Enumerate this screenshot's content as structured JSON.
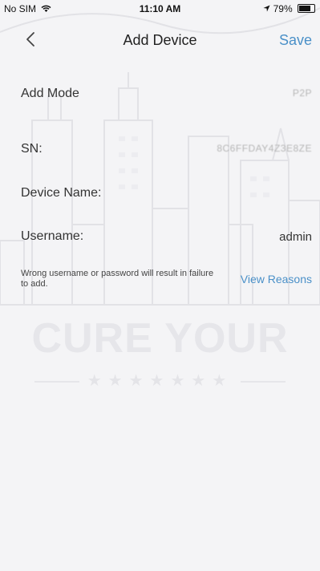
{
  "status_bar": {
    "carrier": "No SIM",
    "wifi_icon": "wifi-icon",
    "time": "11:10 AM",
    "location_icon": "location-arrow-icon",
    "battery_text": "79%",
    "battery_level_percent": 79
  },
  "nav": {
    "back_icon": "chevron-left-icon",
    "title": "Add Device",
    "save_label": "Save"
  },
  "form": {
    "add_mode": {
      "label": "Add Mode",
      "value": "P2P"
    },
    "sn": {
      "label": "SN:",
      "value": "8C6FFDAY4Z3E8ZE"
    },
    "device_name": {
      "label": "Device Name:",
      "value": ""
    },
    "username": {
      "label": "Username:",
      "value": "admin"
    }
  },
  "warning_text": "Wrong username or password will result in failure to add.",
  "view_reasons_label": "View Reasons",
  "watermark_text": "CURE YOUR",
  "colors": {
    "accent": "#4a90c8",
    "background": "#f4f4f6",
    "text": "#333333"
  }
}
